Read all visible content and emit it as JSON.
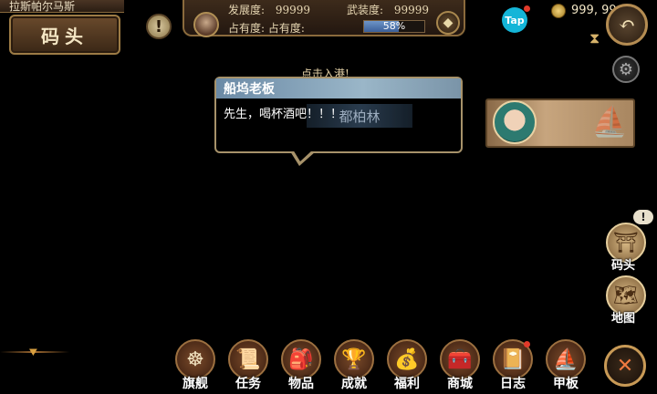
{
  "location": {
    "region": "拉斯帕尔马斯",
    "place": "码头"
  },
  "stats": {
    "development_label": "发展度:",
    "development_value": "99999",
    "armament_label": "武装度:",
    "armament_value": "99999",
    "occupation_label": "占有度: 占有度:",
    "occupation_percent": 58,
    "occupation_text": "58%"
  },
  "top_right": {
    "tap_label": "Tap",
    "coins": "999, 99"
  },
  "hint": "点击入港!",
  "dialog": {
    "speaker": "船坞老板",
    "text": "先生，喝杯酒吧！！！",
    "city": "都柏林"
  },
  "side_buttons": [
    {
      "label": "码头",
      "icon": "dock-icon"
    },
    {
      "label": "地图",
      "icon": "map-icon"
    }
  ],
  "menu": [
    {
      "label": "旗舰",
      "icon": "ship-wheel-icon",
      "glyph": "☸"
    },
    {
      "label": "任务",
      "icon": "scroll-icon",
      "glyph": "📜"
    },
    {
      "label": "物品",
      "icon": "bag-icon",
      "glyph": "🎒"
    },
    {
      "label": "成就",
      "icon": "trophy-icon",
      "glyph": "🏆"
    },
    {
      "label": "福利",
      "icon": "gift-icon",
      "glyph": "💰"
    },
    {
      "label": "商城",
      "icon": "chest-icon",
      "glyph": "🧰"
    },
    {
      "label": "日志",
      "icon": "journal-icon",
      "glyph": "📔"
    },
    {
      "label": "甲板",
      "icon": "galleon-icon",
      "glyph": "⛵"
    }
  ],
  "colors": {
    "background": "#000000",
    "gold_border": "#b48c52",
    "occupation_bar": "#4a72b0",
    "notification_dot": "#e23a2a",
    "tap_brand": "#14b5d8"
  }
}
